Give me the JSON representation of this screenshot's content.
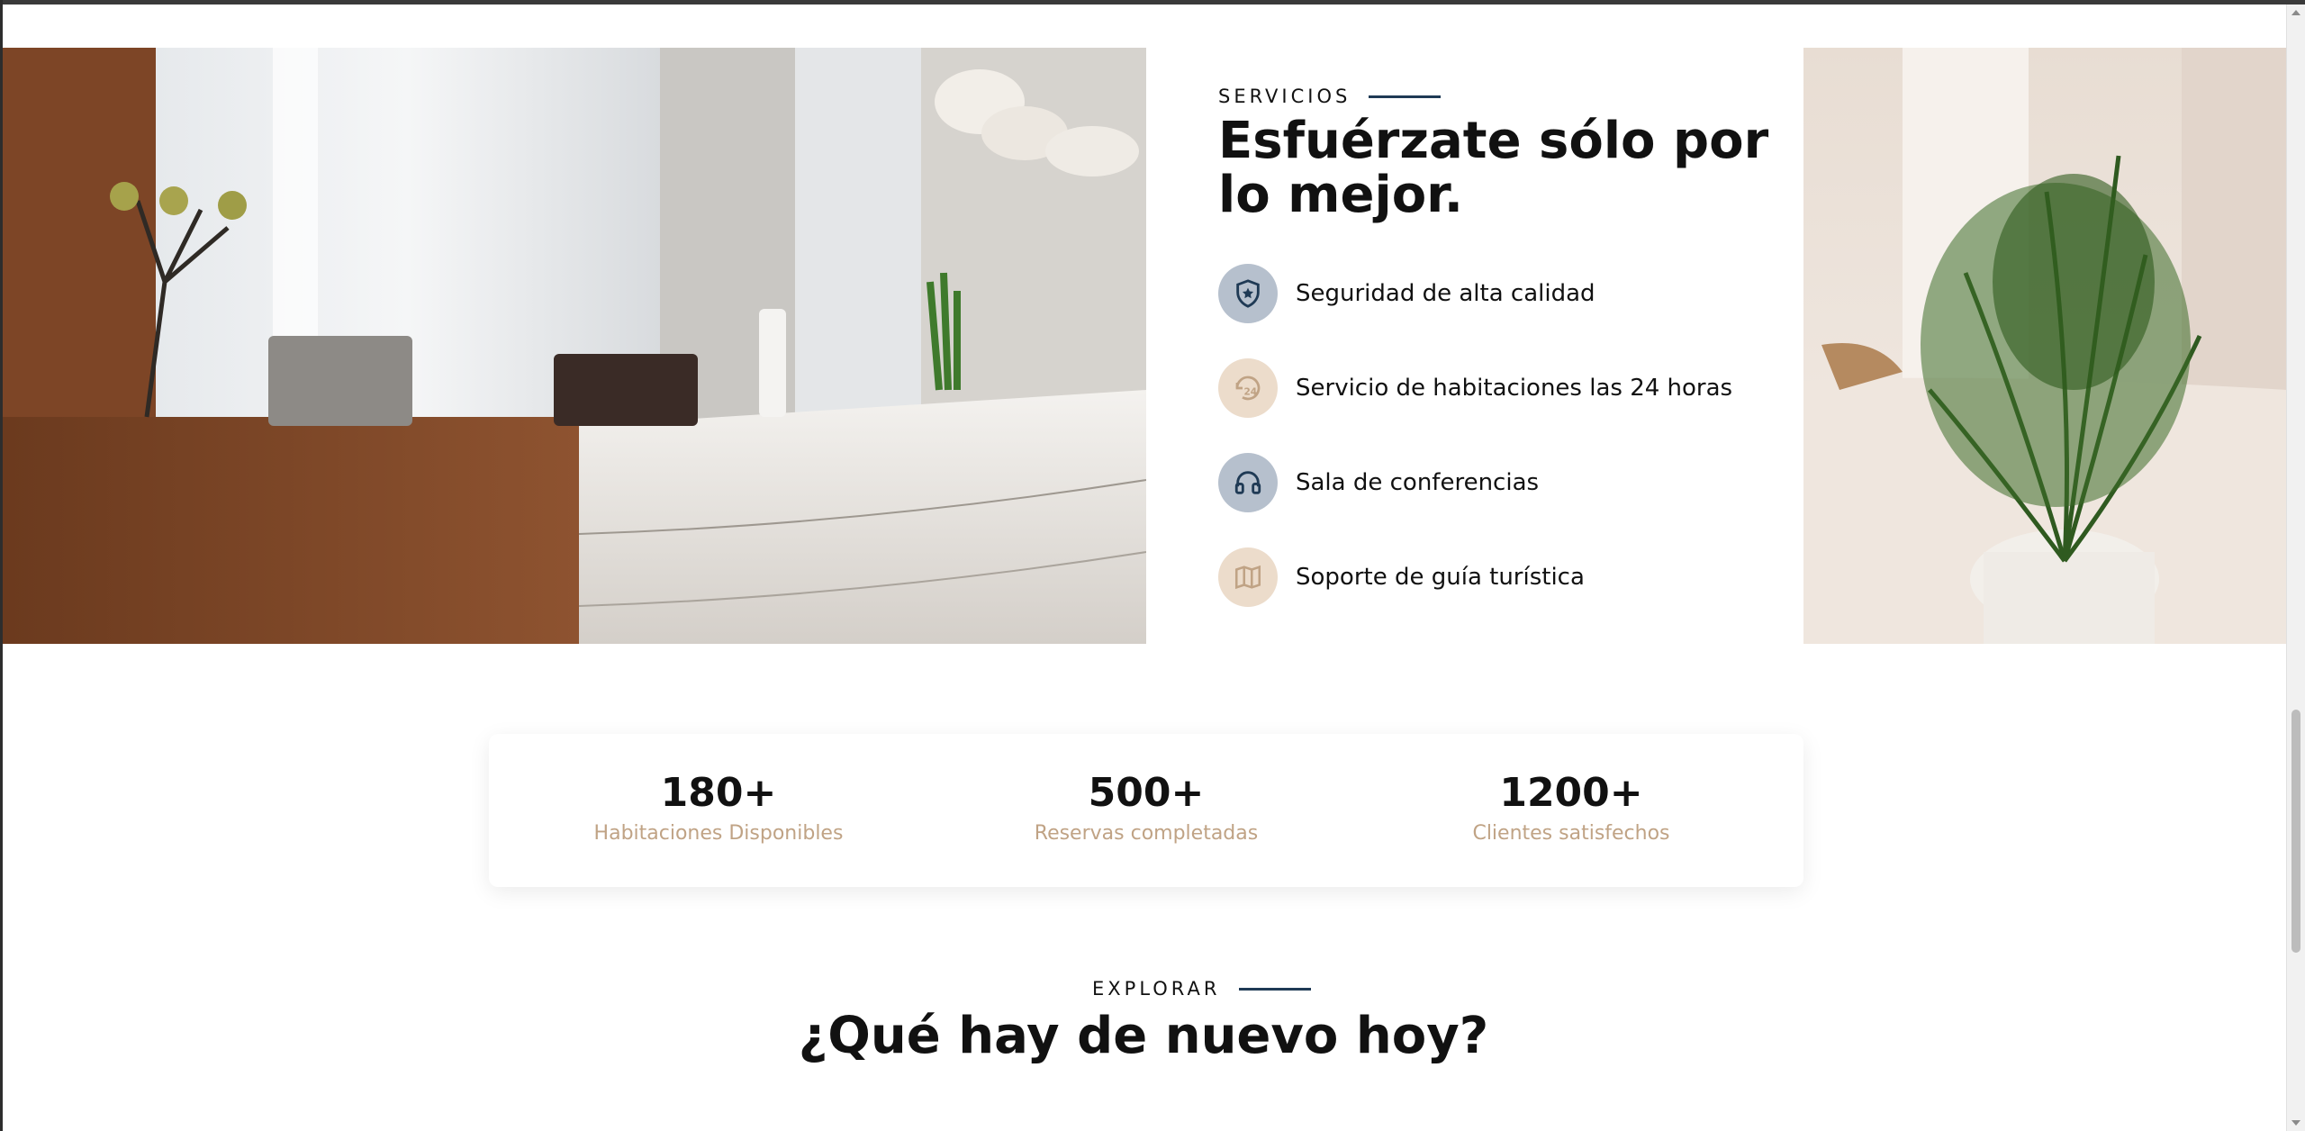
{
  "services": {
    "eyebrow": "SERVICIOS",
    "title": "Esfuérzate sólo por lo mejor.",
    "features": [
      {
        "icon": "shield-star-icon",
        "label": "Seguridad de alta calidad"
      },
      {
        "icon": "24h-service-icon",
        "label": "Servicio de habitaciones las 24 horas"
      },
      {
        "icon": "headphones-icon",
        "label": "Sala de conferencias"
      },
      {
        "icon": "map-icon",
        "label": "Soporte de guía turística"
      }
    ]
  },
  "stats": [
    {
      "value": "180+",
      "caption": "Habitaciones Disponibles"
    },
    {
      "value": "500+",
      "caption": "Reservas completadas"
    },
    {
      "value": "1200+",
      "caption": "Clientes satisfechos"
    }
  ],
  "explore": {
    "eyebrow": "EXPLORAR",
    "title": "¿Qué hay de nuevo hoy?"
  },
  "colors": {
    "accent_navy": "#1f3a55",
    "accent_sand": "#c0a385",
    "icon_bg_slate": "#b6c0cd",
    "icon_bg_sand": "#ecdccb"
  }
}
